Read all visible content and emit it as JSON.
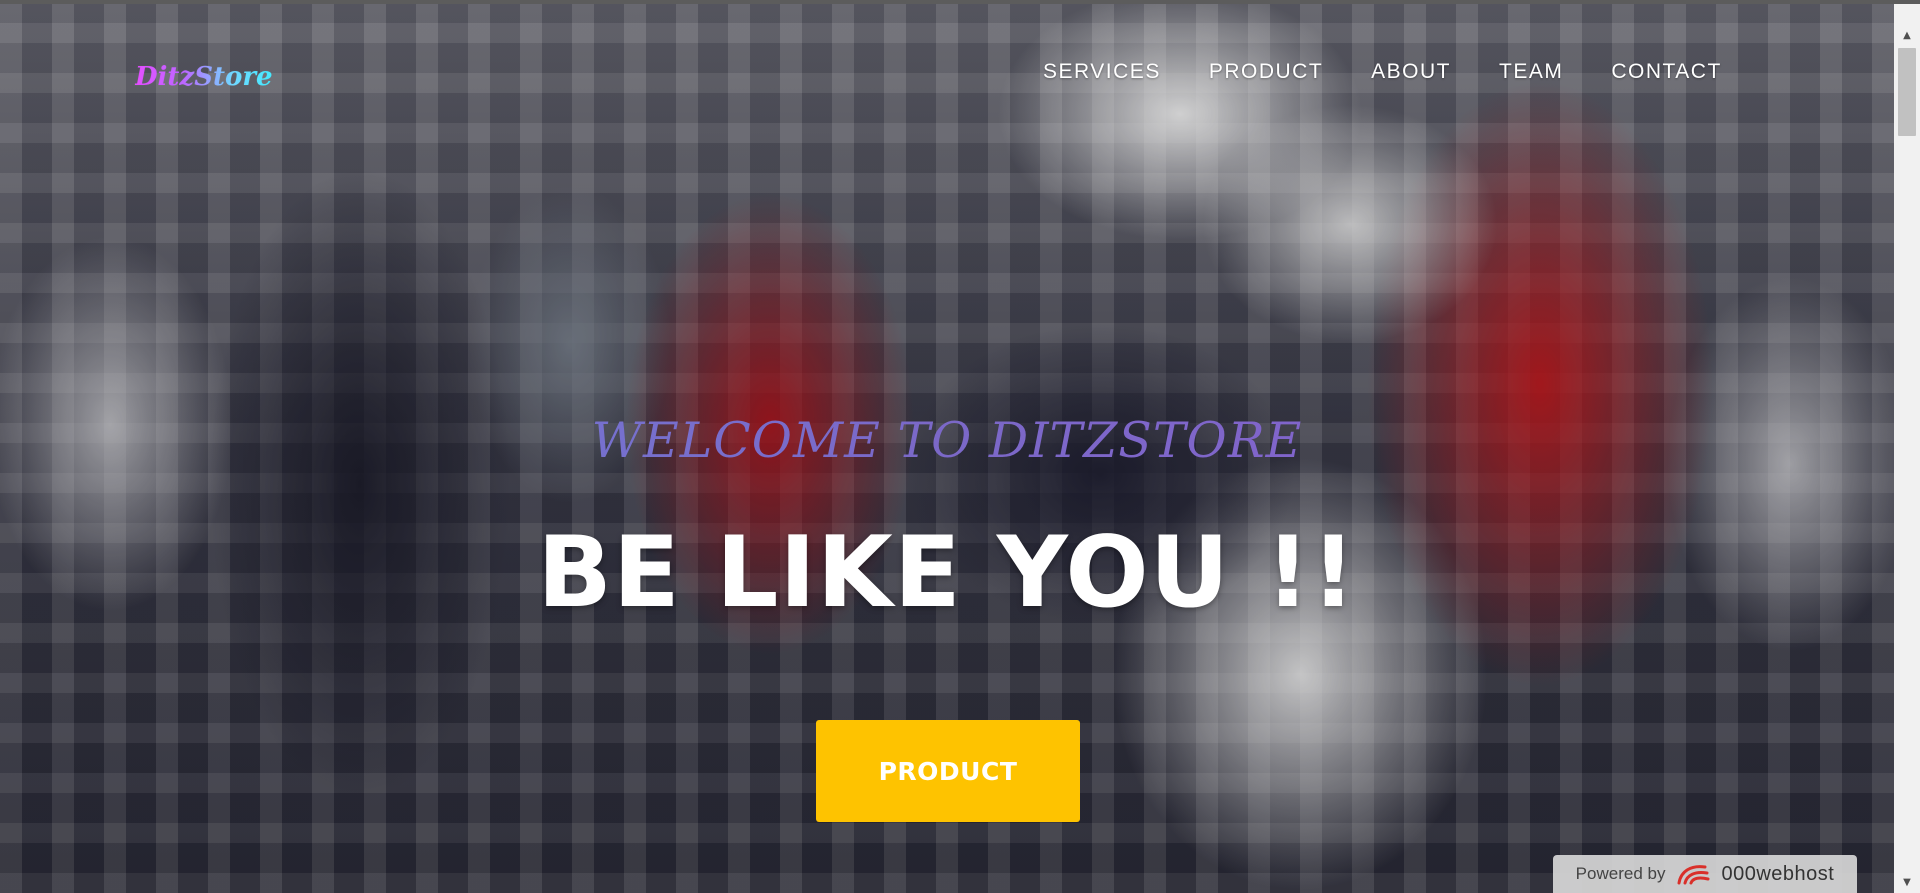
{
  "header": {
    "logo": "DitzStore",
    "nav": [
      {
        "label": "SERVICES"
      },
      {
        "label": "PRODUCT"
      },
      {
        "label": "ABOUT"
      },
      {
        "label": "TEAM"
      },
      {
        "label": "CONTACT"
      }
    ]
  },
  "hero": {
    "welcome": "WELCOME TO DITZSTORE",
    "headline": "BE LIKE YOU !!",
    "cta_label": "PRODUCT"
  },
  "badge": {
    "powered_by": "Powered by",
    "brand": "000webhost"
  },
  "colors": {
    "cta": "#fec300",
    "welcome_text": "#7b68c8",
    "nav_text": "#ffffff"
  },
  "icons": {
    "scroll_up": "triangle-up",
    "scroll_down": "triangle-down",
    "host_logo": "000webhost-swirl"
  }
}
